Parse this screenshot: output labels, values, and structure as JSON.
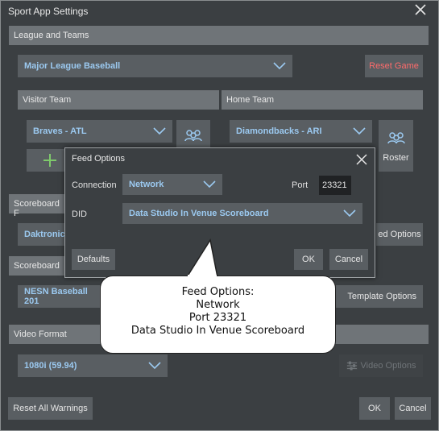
{
  "window": {
    "title": "Sport App Settings"
  },
  "league_section": {
    "header": "League and Teams",
    "league_value": "Major League Baseball",
    "reset_game": "Reset Game",
    "visitor_header": "Visitor Team",
    "home_header": "Home Team",
    "visitor_value": "Braves - ATL",
    "home_value": "Diamondbacks - ARI",
    "roster_label": "Roster"
  },
  "scoreboard_feed_section": {
    "header": "Scoreboard F",
    "value": "Daktronics",
    "feed_options": "ed Options"
  },
  "scoreboard_section": {
    "header": "Scoreboard",
    "value": "NESN Baseball 201",
    "template_options": "Template Options"
  },
  "video_section": {
    "header": "Video Format",
    "value": "1080i (59.94)",
    "video_options": "Video Options"
  },
  "footer": {
    "reset_warnings": "Reset All Warnings",
    "ok": "OK",
    "cancel": "Cancel"
  },
  "dialog": {
    "title": "Feed Options",
    "connection_label": "Connection",
    "connection_value": "Network",
    "port_label": "Port",
    "port_value": "23321",
    "did_label": "DID",
    "did_value": "Data Studio In Venue Scoreboard",
    "defaults": "Defaults",
    "ok": "OK",
    "cancel": "Cancel"
  },
  "callout": {
    "line1": "Feed Options:",
    "line2": "Network",
    "line3": "Port 23321",
    "line4": "Data Studio In Venue Scoreboard"
  },
  "colors": {
    "window_bg": "#3b3f42",
    "section_header": "#6f7478",
    "dropdown_bg": "#595e62",
    "dropdown_text": "#9bc9f0",
    "reset_game_text": "#ff6b6b"
  },
  "icons": [
    "close-icon",
    "chevron-down-icon",
    "roster-icon",
    "add-icon",
    "sliders-icon"
  ]
}
